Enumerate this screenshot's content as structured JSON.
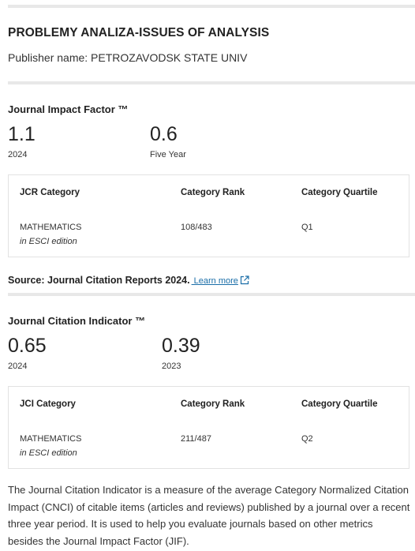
{
  "journal": {
    "title": "PROBLEMY ANALIZA-ISSUES OF ANALYSIS",
    "publisher": "Publisher name: PETROZAVODSK STATE UNIV"
  },
  "jif": {
    "heading": "Journal Impact Factor ™",
    "value": "1.1",
    "year": "2024",
    "five_year_value": "0.6",
    "five_year_label": "Five Year",
    "columns": [
      "JCR Category",
      "Category Rank",
      "Category Quartile"
    ],
    "row": {
      "category": "MATHEMATICS",
      "edition": "in ESCI edition",
      "rank": "108/483",
      "quartile": "Q1"
    }
  },
  "source": {
    "text": "Source: Journal Citation Reports  2024.",
    "link": " Learn more",
    "icon": "external-link-icon"
  },
  "jci": {
    "heading": "Journal Citation Indicator ™",
    "value": "0.65",
    "year": "2024",
    "prev_value": "0.39",
    "prev_year": "2023",
    "columns": [
      "JCI Category",
      "Category Rank",
      "Category Quartile"
    ],
    "row": {
      "category": "MATHEMATICS",
      "edition": "in ESCI edition",
      "rank": "211/487",
      "quartile": "Q2"
    }
  },
  "description": "The Journal Citation Indicator is a measure of the average Category Normalized Citation Impact (CNCI) of citable items (articles and reviews) published by a journal over a recent three year period. It is used to help you evaluate journals based on other metrics besides the Journal Impact Factor (JIF).",
  "colors": {
    "link": "#1a6ea8",
    "divider": "#e8e8e8",
    "box_border": "#e2e2e2"
  }
}
